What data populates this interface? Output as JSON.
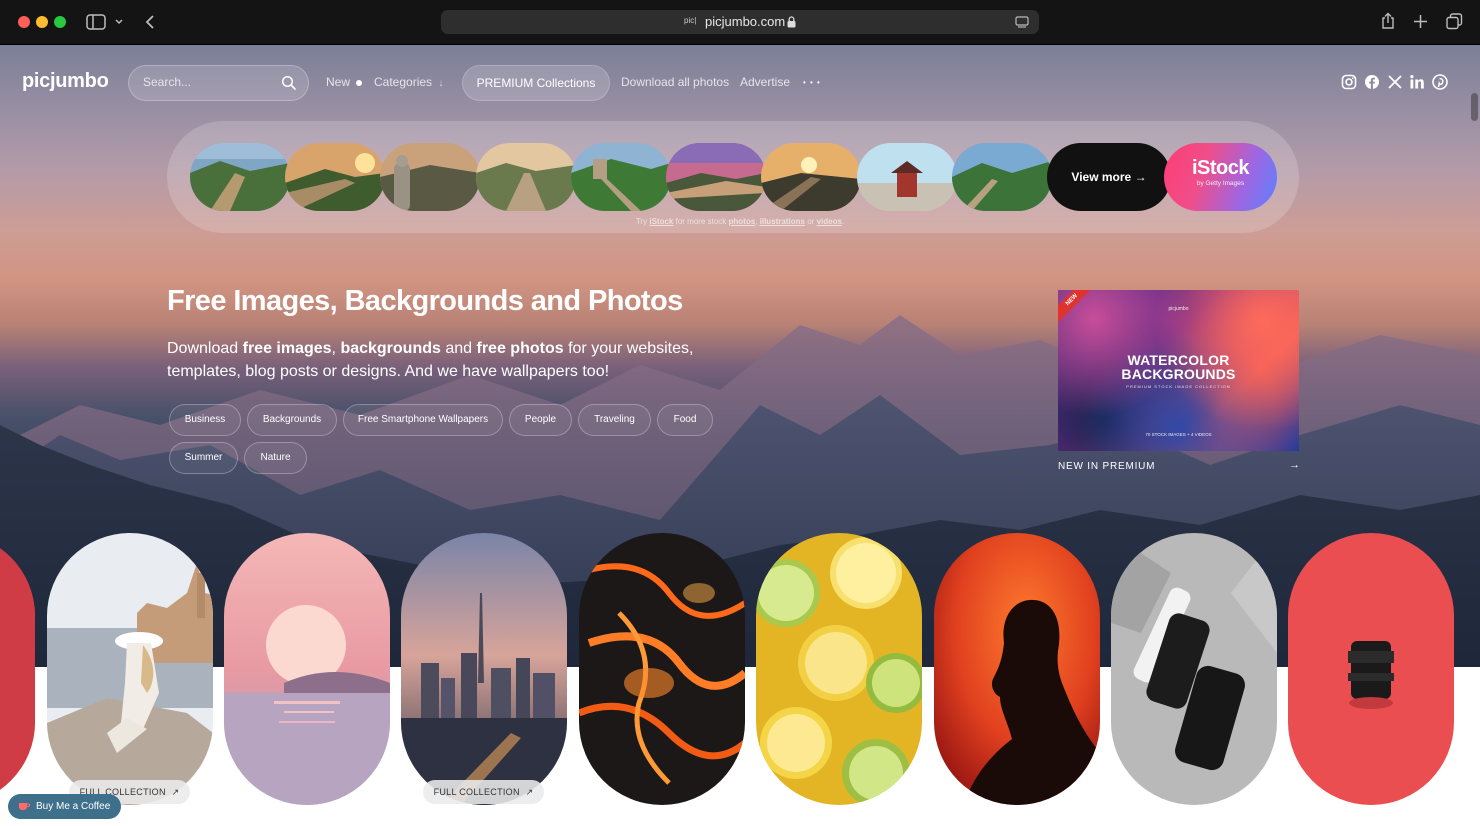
{
  "browser": {
    "url": "picjumbo.com",
    "favicon_text": "pic|"
  },
  "nav": {
    "logo": "picjumbo",
    "search_placeholder": "Search...",
    "new_label": "New",
    "categories_label": "Categories",
    "categories_arrow": "↓",
    "premium_label": "PREMIUM Collections",
    "download_all_label": "Download all photos",
    "advertise_label": "Advertise",
    "more_label": "• • •"
  },
  "social_icons": [
    "instagram-icon",
    "facebook-icon",
    "x-icon",
    "linkedin-icon",
    "pinterest-icon"
  ],
  "strip": {
    "view_more_label": "View more →",
    "istock_brand": "iStock",
    "istock_sub": "by Getty Images",
    "note_prefix": "Try",
    "note_istock": "iStock",
    "note_middle": "for more stock",
    "note_photos": "photos",
    "note_illustrations": "illustrations",
    "note_or": "or",
    "note_videos": "videos"
  },
  "hero": {
    "title": "Free Images, Backgrounds and Photos",
    "sub_1": "Download ",
    "sub_b1": "free images",
    "sub_2": ", ",
    "sub_b2": "backgrounds",
    "sub_3": " and ",
    "sub_b3": "free photos",
    "sub_4": " for your websites, templates, blog posts or designs. And we have wallpapers too!",
    "tags": [
      "Business",
      "Backgrounds",
      "Free Smartphone Wallpapers",
      "People",
      "Traveling",
      "Food",
      "Summer",
      "Nature"
    ]
  },
  "premium_card": {
    "ribbon": "NEW",
    "brand": "picjumbo",
    "title_line1": "WATERCOLOR",
    "title_line2": "BACKGROUNDS",
    "caption": "PREMIUM STOCK IMAGE COLLECTION",
    "count": "70 STOCK IMAGES + 4 VIDEOS",
    "label": "NEW IN PREMIUM",
    "arrow": "→"
  },
  "gallery": {
    "full_collection_label": "FULL COLLECTION",
    "external_icon": "↗"
  },
  "coffee": {
    "label": "Buy Me a Coffee"
  },
  "colors": {
    "accent_pink": "#ff3d74",
    "coffee_blue": "#3e6f8b",
    "chrome_dark": "#141414"
  }
}
